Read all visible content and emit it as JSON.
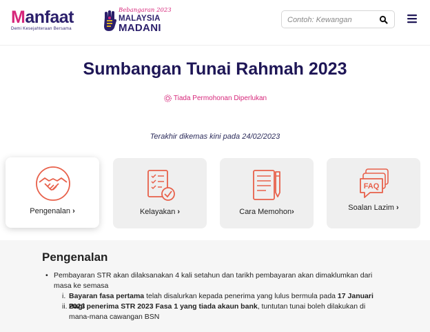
{
  "header": {
    "logo": {
      "word_m": "M",
      "word_rest": "anfaat",
      "tagline": "Demi Kesejahteraan Bersama"
    },
    "madani": {
      "script": "Bebangaran 2023",
      "line1": "MALAYSIA",
      "line2": "MADANI"
    },
    "search": {
      "placeholder": "Contoh: Kewangan"
    },
    "icons": {
      "search": "search-icon",
      "menu": "hamburger-menu-icon"
    }
  },
  "page": {
    "title": "Sumbangan Tunai Rahmah 2023",
    "badge": "Tiada Permohonan Diperlukan",
    "updated": "Terakhir dikemas kini pada 24/02/2023"
  },
  "cards": [
    {
      "label": "Pengenalan",
      "icon": "handshake-icon",
      "active": true
    },
    {
      "label": "Kelayakan",
      "icon": "checklist-icon",
      "active": false
    },
    {
      "label": "Cara Memohon",
      "icon": "form-pen-icon",
      "active": false
    },
    {
      "label": "Soalan Lazim",
      "icon": "faq-icon",
      "active": false
    }
  ],
  "chevron": "›",
  "intro": {
    "heading": "Pengenalan",
    "bullet": "•",
    "p1": "Pembayaran STR akan dilaksanakan 4 kali setahun dan tarikh pembayaran akan dimaklumkan dari masa ke semasa",
    "items": [
      {
        "num": "i.",
        "bold1": "Bayaran fasa pertama",
        "text1": " telah disalurkan kepada penerima yang lulus bermula pada ",
        "bold2": "17 Januari 2023",
        "text2": ""
      },
      {
        "num": "ii.",
        "bold1": "Bagi penerima STR 2023 Fasa 1 yang tiada akaun bank",
        "text1": ", tuntutan tunai boleh dilakukan di mana-mana cawangan BSN",
        "bold2": "",
        "text2": ""
      }
    ]
  },
  "colors": {
    "navy": "#1e1656",
    "brand_pink": "#d6267a",
    "icon_orange": "#e8604a",
    "card_bg": "#efefef"
  }
}
